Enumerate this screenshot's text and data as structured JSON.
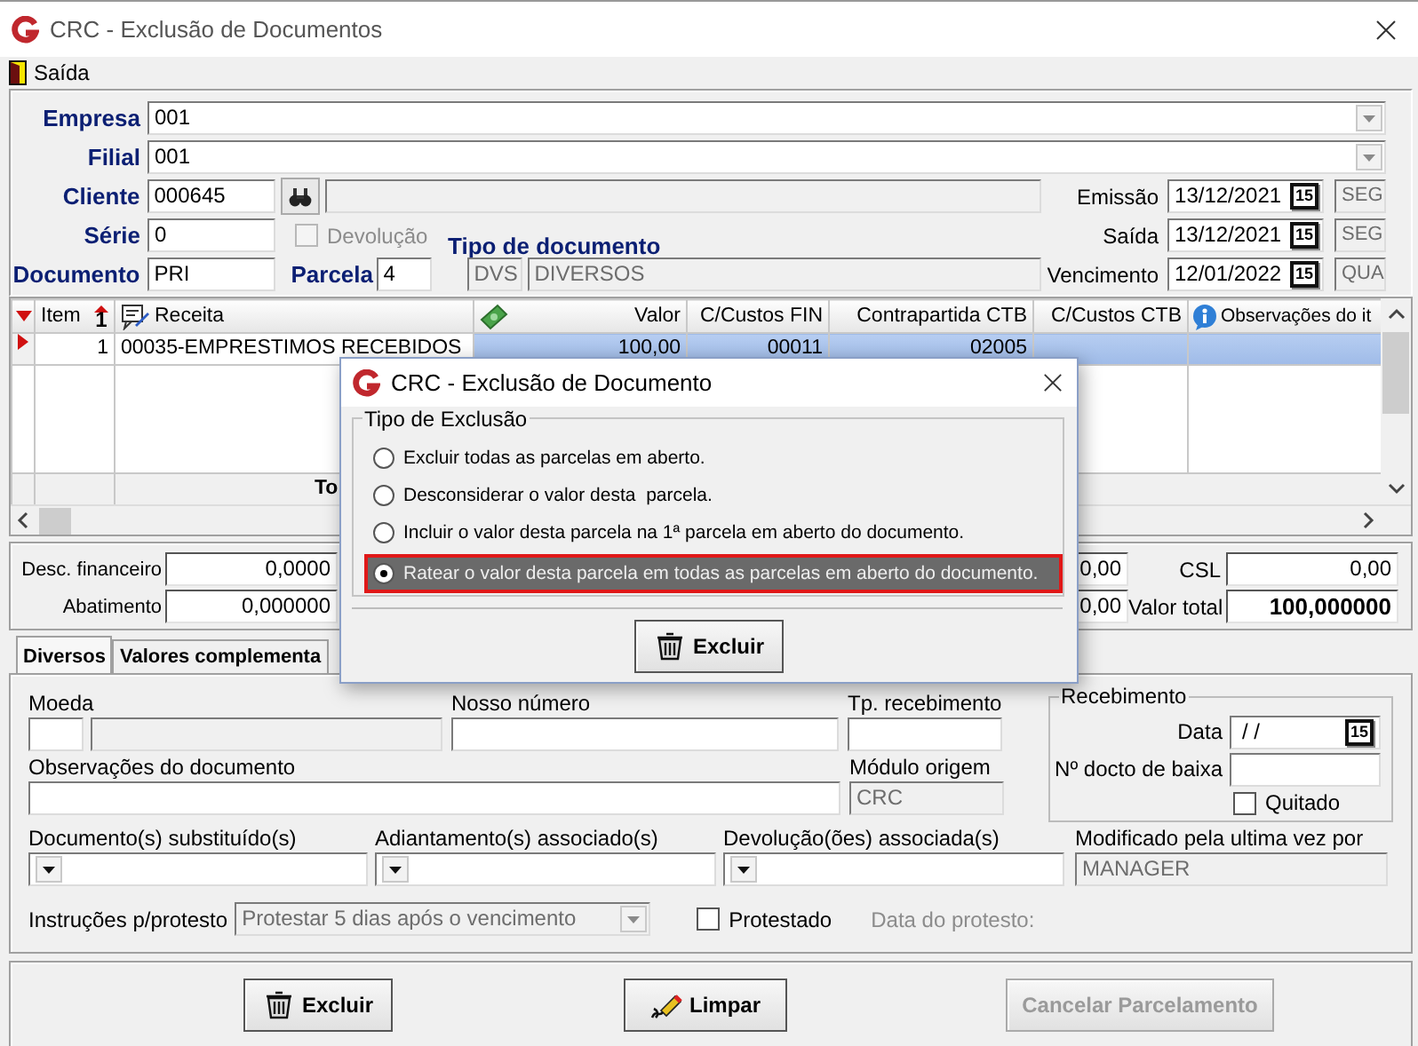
{
  "window": {
    "title": "CRC - Exclusão de Documentos"
  },
  "menu": [
    {
      "label": "Saída"
    }
  ],
  "header": {
    "empresa": {
      "label": "Empresa",
      "value": "001"
    },
    "filial": {
      "label": "Filial",
      "value": "001"
    },
    "cliente": {
      "label": "Cliente",
      "value": "000645"
    },
    "serie": {
      "label": "Série",
      "value": "0"
    },
    "documento": {
      "label": "Documento",
      "value": "PRI"
    },
    "devolucao": {
      "label": "Devolução",
      "checked": false,
      "disabled": true
    },
    "parcela": {
      "label": "Parcela",
      "value": "4"
    },
    "tipo_documento": {
      "label": "Tipo de documento",
      "code": "DVS",
      "name": "DIVERSOS"
    },
    "dates": [
      {
        "label": "Emissão",
        "value": "13/12/2021",
        "picker": "15",
        "weekday": "SEG"
      },
      {
        "label": "Saída",
        "value": "13/12/2021",
        "picker": "15",
        "weekday": "SEG"
      },
      {
        "label": "Vencimento",
        "value": "12/01/2022",
        "picker": "15",
        "weekday": "QUA"
      }
    ]
  },
  "grid": {
    "columns": [
      {
        "label": "Item",
        "kind": "sort",
        "sort_rank": "1"
      },
      {
        "label": "Receita",
        "kind": "note"
      },
      {
        "label": "Valor",
        "kind": "money"
      },
      {
        "label": "C/Custos FIN",
        "kind": "plain"
      },
      {
        "label": "Contrapartida CTB",
        "kind": "plain"
      },
      {
        "label": "C/Custos CTB",
        "kind": "plain"
      },
      {
        "label": "Observações do it",
        "kind": "info"
      }
    ],
    "rows": [
      {
        "cells": [
          "1",
          "00035-EMPRESTIMOS RECEBIDOS",
          "100,00",
          "00011",
          "02005"
        ],
        "selected": true
      }
    ],
    "footer": {
      "label": "To"
    }
  },
  "totals": {
    "left": [
      {
        "label": "Desc. financeiro",
        "value": "0,0000"
      },
      {
        "label": "Abatimento",
        "value": "0,000000"
      }
    ],
    "middle": [
      "0,00",
      "0,00"
    ],
    "right": [
      {
        "label": "CSL",
        "value": "0,00"
      },
      {
        "label": "Valor total",
        "value": "100,000000"
      }
    ]
  },
  "tabs": [
    {
      "label": "Diversos",
      "selected": true
    },
    {
      "label": "Valores complementa",
      "selected": false
    }
  ],
  "diversos": {
    "moeda": {
      "label": "Moeda"
    },
    "nosso_numero": {
      "label": "Nosso número"
    },
    "tp_recebimento": {
      "label": "Tp. recebimento"
    },
    "observacoes": {
      "label": "Observações do documento"
    },
    "modulo_origem": {
      "label": "Módulo origem",
      "value": "CRC"
    },
    "associations": [
      {
        "label": "Documento(s) substituído(s)"
      },
      {
        "label": "Adiantamento(s) associado(s)"
      },
      {
        "label": "Devolução(ões) associada(s)"
      }
    ],
    "modificado": {
      "label": "Modificado pela ultima vez por",
      "value": "MANAGER"
    },
    "instrucoes": {
      "label": "Instruções p/protesto",
      "value": "Protestar 5 dias após o vencimento",
      "disabled": true
    },
    "protestado": {
      "label": "Protestado",
      "checked": false
    },
    "data_protesto": {
      "label": "Data do protesto:",
      "disabled": true
    }
  },
  "recebimento": {
    "title": "Recebimento",
    "data": {
      "label": "Data",
      "value": "/ /",
      "picker": "15"
    },
    "docto": {
      "label": "Nº docto de baixa"
    },
    "quitado": {
      "label": "Quitado",
      "checked": false
    }
  },
  "buttons": [
    {
      "label": "Excluir",
      "kind": "delete",
      "disabled": false
    },
    {
      "label": "Limpar",
      "kind": "clear",
      "disabled": false
    },
    {
      "label": "Cancelar Parcelamento",
      "kind": "plain",
      "disabled": true
    }
  ],
  "dialog": {
    "title": "CRC - Exclusão de Documento",
    "group": "Tipo de Exclusão",
    "options": [
      {
        "label": "Excluir todas as parcelas em aberto.",
        "selected": false
      },
      {
        "label": "Desconsiderar o valor desta  parcela.",
        "selected": false
      },
      {
        "label": "Incluir o valor desta parcela na 1ª parcela em aberto do documento.",
        "selected": false
      },
      {
        "label": "Ratear o valor desta parcela em todas as parcelas em aberto do documento.",
        "selected": true
      }
    ],
    "button": {
      "label": "Excluir",
      "kind": "delete"
    }
  }
}
